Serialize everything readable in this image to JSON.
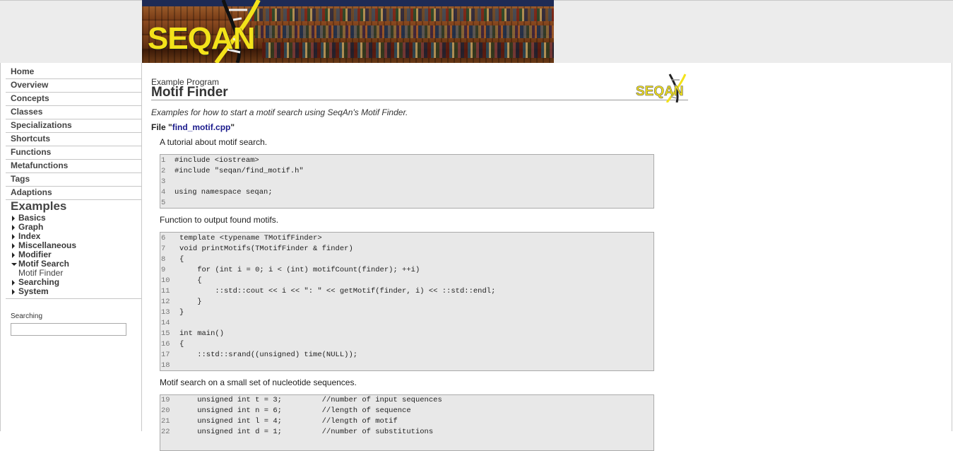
{
  "banner": {
    "logo_text": "SEQAN"
  },
  "sidebar": {
    "nav": [
      "Home",
      "Overview",
      "Concepts",
      "Classes",
      "Specializations",
      "Shortcuts",
      "Functions",
      "Metafunctions",
      "Tags",
      "Adaptions"
    ],
    "examples_heading": "Examples",
    "examples": [
      "Basics",
      "Graph",
      "Index",
      "Miscellaneous",
      "Modifier",
      "Motif Search",
      "Motif Finder",
      "Searching",
      "System"
    ],
    "search_label": "Searching",
    "search_value": ""
  },
  "main": {
    "subtitle": "Example Program",
    "title": "Motif Finder",
    "small_logo": "SEQAN",
    "intro": "Examples for how to start a motif search using SeqAn's Motif Finder.",
    "file_prefix": "File \"",
    "file_name": "find_motif.cpp",
    "file_suffix": "\"",
    "para1": "A tutorial about motif search.",
    "code1": [
      {
        "n": "1",
        "t": "#include <iostream>"
      },
      {
        "n": "2",
        "t": "#include \"seqan/find_motif.h\""
      },
      {
        "n": "3",
        "t": ""
      },
      {
        "n": "4",
        "t": "using namespace seqan;"
      },
      {
        "n": "5",
        "t": ""
      }
    ],
    "para2": "Function to output found motifs.",
    "code2": [
      {
        "n": "6",
        "t": "template <typename TMotifFinder>"
      },
      {
        "n": "7",
        "t": "void printMotifs(TMotifFinder & finder)"
      },
      {
        "n": "8",
        "t": "{"
      },
      {
        "n": "9",
        "t": "    for (int i = 0; i < (int) motifCount(finder); ++i)"
      },
      {
        "n": "10",
        "t": "    {"
      },
      {
        "n": "11",
        "t": "        ::std::cout << i << \": \" << getMotif(finder, i) << ::std::endl;"
      },
      {
        "n": "12",
        "t": "    }"
      },
      {
        "n": "13",
        "t": "}"
      },
      {
        "n": "14",
        "t": ""
      },
      {
        "n": "15",
        "t": "int main()"
      },
      {
        "n": "16",
        "t": "{"
      },
      {
        "n": "17",
        "t": "    ::std::srand((unsigned) time(NULL));"
      },
      {
        "n": "18",
        "t": ""
      }
    ],
    "para3": "Motif search on a small set of nucleotide sequences.",
    "code3": [
      {
        "n": "19",
        "t": "    unsigned int t = 3;         //number of input sequences"
      },
      {
        "n": "20",
        "t": "    unsigned int n = 6;         //length of sequence"
      },
      {
        "n": "21",
        "t": "    unsigned int l = 4;         //length of motif"
      },
      {
        "n": "22",
        "t": "    unsigned int d = 1;         //number of substitutions"
      }
    ]
  }
}
